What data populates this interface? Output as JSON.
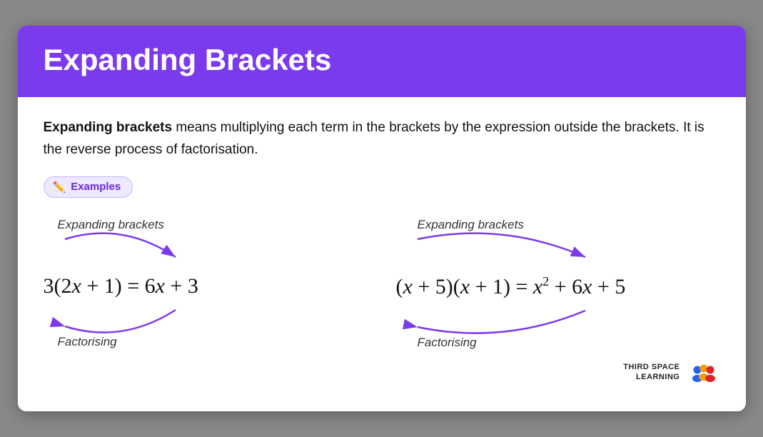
{
  "header": {
    "title": "Expanding Brackets",
    "bg_color": "#7c3aed"
  },
  "definition": {
    "bold_part": "Expanding brackets",
    "rest": " means multiplying each term in the brackets by the expression outside the brackets. It is the reverse process of factorisation."
  },
  "badge": {
    "label": "Examples"
  },
  "examples": [
    {
      "label": "Expanding brackets",
      "expanding_arrow_label": "Expanding brackets",
      "math": "3(2x + 1) = 6x + 3",
      "factorising_label": "Factorising"
    },
    {
      "label": "Expanding brackets",
      "expanding_arrow_label": "Expanding brackets",
      "math_html": "(x + 5)(x + 1) = x<sup>2</sup> + 6x + 5",
      "factorising_label": "Factorising"
    }
  ],
  "logo": {
    "line1": "THIRD SPACE",
    "line2": "LEARNING"
  }
}
